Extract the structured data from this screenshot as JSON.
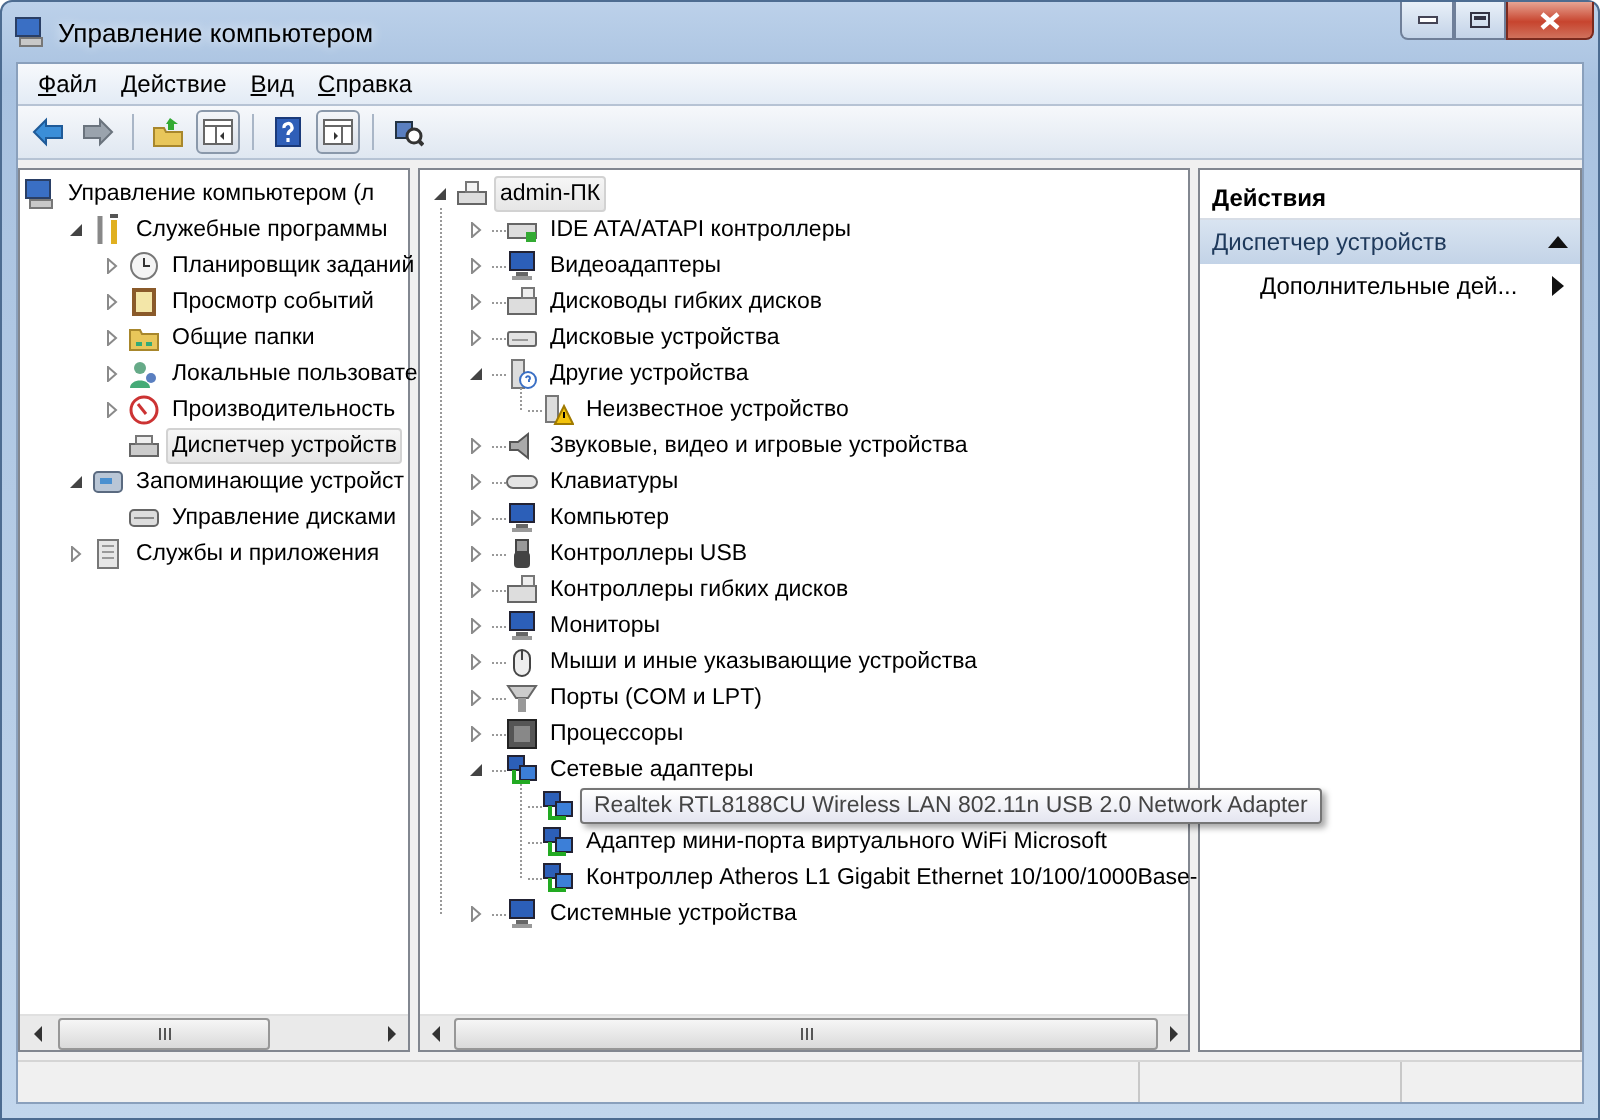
{
  "window": {
    "title": "Управление компьютером"
  },
  "menu": [
    {
      "label": "Файл"
    },
    {
      "label": "Действие"
    },
    {
      "label": "Вид"
    },
    {
      "label": "Справка"
    }
  ],
  "nav_tree": [
    {
      "label": "Управление компьютером (л",
      "kind": "computer",
      "selected": false,
      "children": [
        {
          "label": "Служебные программы",
          "kind": "tools",
          "selected": false,
          "expanded": true,
          "children": [
            {
              "label": "Планировщик заданий",
              "kind": "clock",
              "selected": false,
              "expanded": false
            },
            {
              "label": "Просмотр событий",
              "kind": "log",
              "selected": false,
              "expanded": false
            },
            {
              "label": "Общие папки",
              "kind": "folder",
              "selected": false,
              "expanded": false
            },
            {
              "label": "Локальные пользовате",
              "kind": "users",
              "selected": false,
              "expanded": false
            },
            {
              "label": "Производительность",
              "kind": "gauge",
              "selected": false,
              "expanded": false
            },
            {
              "label": "Диспетчер устройств",
              "kind": "devmgr",
              "selected": true
            }
          ]
        },
        {
          "label": "Запоминающие устройст",
          "kind": "storage",
          "selected": false,
          "expanded": true,
          "children": [
            {
              "label": "Управление дисками",
              "kind": "disk",
              "selected": false
            }
          ]
        },
        {
          "label": "Службы и приложения",
          "kind": "services",
          "selected": false,
          "expanded": false
        }
      ]
    }
  ],
  "device_tree": [
    {
      "label": "admin-ПК",
      "kind": "pc",
      "selected": true,
      "expanded": true,
      "children": [
        {
          "label": "IDE ATA/ATAPI контроллеры",
          "kind": "card",
          "selected": false,
          "expanded": false
        },
        {
          "label": "Видеоадаптеры",
          "kind": "display",
          "selected": false,
          "expanded": false
        },
        {
          "label": "Дисководы гибких дисков",
          "kind": "floppy",
          "selected": false,
          "expanded": false
        },
        {
          "label": "Дисковые устройства",
          "kind": "drive",
          "selected": false,
          "expanded": false
        },
        {
          "label": "Другие устройства",
          "kind": "unknown",
          "selected": false,
          "expanded": true,
          "children": [
            {
              "label": "Неизвестное устройство",
              "kind": "warning",
              "selected": false
            }
          ]
        },
        {
          "label": "Звуковые, видео и игровые устройства",
          "kind": "speaker",
          "selected": false,
          "expanded": false
        },
        {
          "label": "Клавиатуры",
          "kind": "keyboard",
          "selected": false,
          "expanded": false
        },
        {
          "label": "Компьютер",
          "kind": "display",
          "selected": false,
          "expanded": false
        },
        {
          "label": "Контроллеры USB",
          "kind": "usb",
          "selected": false,
          "expanded": false
        },
        {
          "label": "Контроллеры гибких дисков",
          "kind": "floppy",
          "selected": false,
          "expanded": false
        },
        {
          "label": "Мониторы",
          "kind": "display",
          "selected": false,
          "expanded": false
        },
        {
          "label": "Мыши и иные указывающие устройства",
          "kind": "mouse",
          "selected": false,
          "expanded": false
        },
        {
          "label": "Порты (COM и LPT)",
          "kind": "port",
          "selected": false,
          "expanded": false
        },
        {
          "label": "Процессоры",
          "kind": "cpu",
          "selected": false,
          "expanded": false
        },
        {
          "label": "Сетевые адаптеры",
          "kind": "network",
          "selected": false,
          "expanded": true,
          "children": [
            {
              "label": "Realtek RTL8188CU Wireless LAN 802.11n USB 2.0 Network Adapter",
              "kind": "network",
              "selected": false,
              "tooltip": true
            },
            {
              "label": "Адаптер мини-порта виртуального WiFi Microsoft",
              "kind": "network",
              "selected": false,
              "tooltip": false
            },
            {
              "label": "Контроллер Atheros L1 Gigabit Ethernet 10/100/1000Base-",
              "kind": "network",
              "selected": false,
              "tooltip": false
            }
          ]
        },
        {
          "label": "Системные устройства",
          "kind": "display",
          "selected": false,
          "expanded": false
        }
      ]
    }
  ],
  "actions": {
    "header": "Действия",
    "sections": [
      {
        "title": "Диспетчер устройств",
        "expanded": true,
        "items": [
          {
            "label": "Дополнительные дей...",
            "has_submenu": true
          }
        ]
      }
    ]
  }
}
